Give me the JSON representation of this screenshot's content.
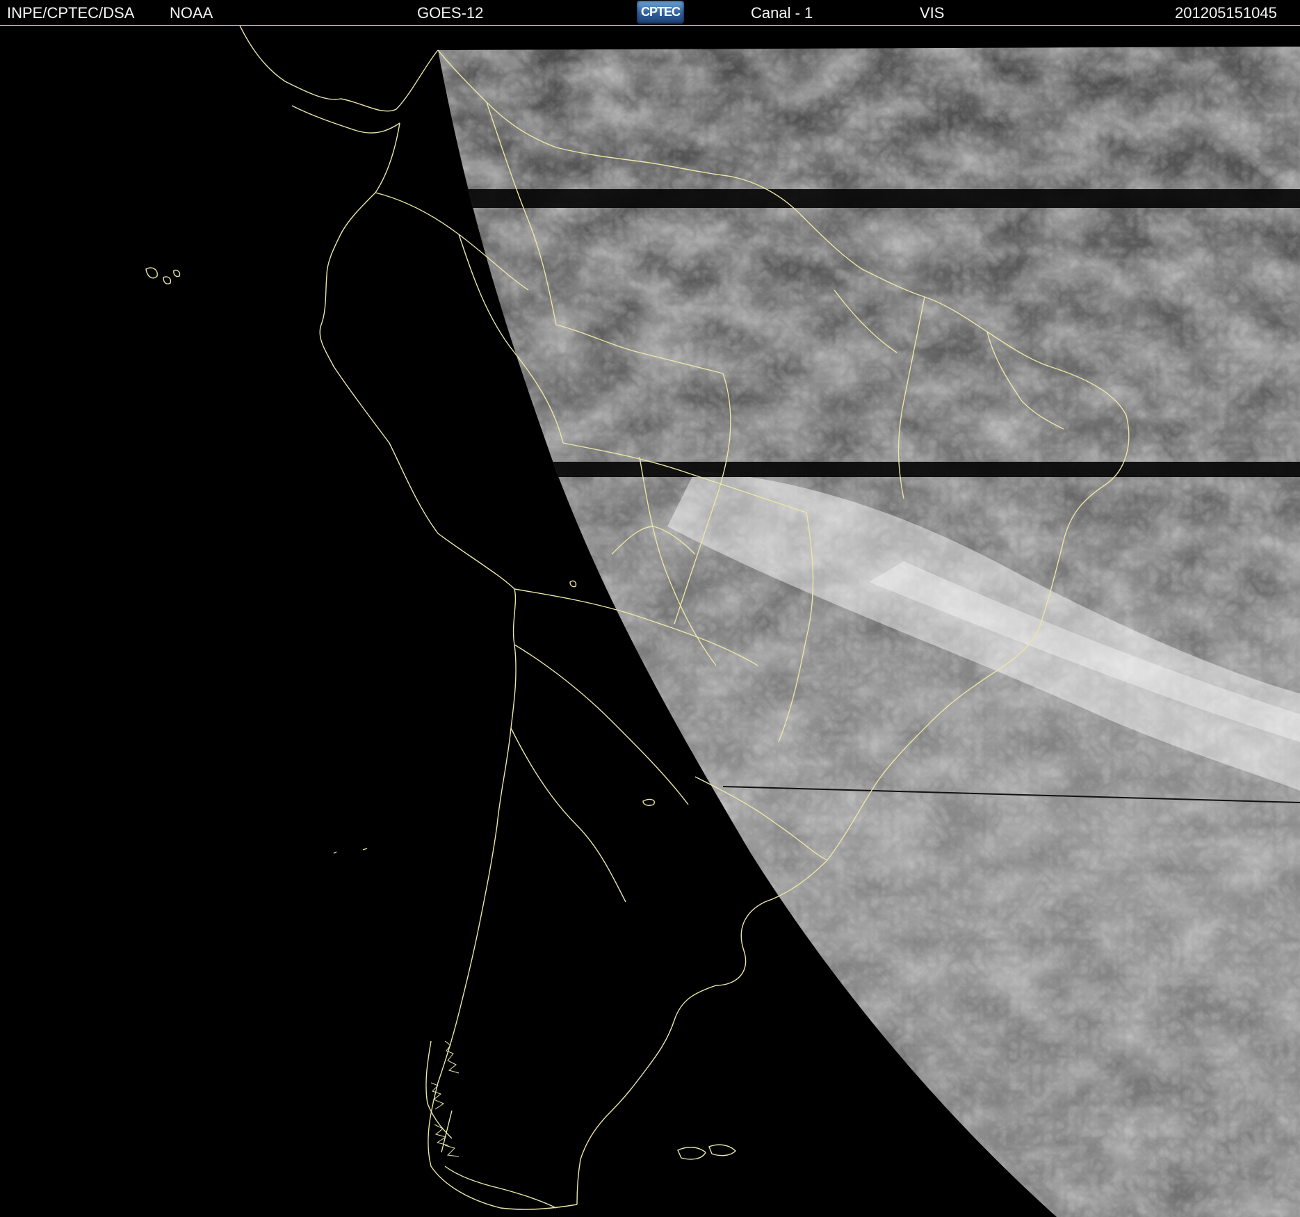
{
  "header": {
    "agency": "INPE/CPTEC/DSA",
    "partner": "NOAA",
    "satellite": "GOES-12",
    "logo_text": "CPTEC",
    "channel": "Canal - 1",
    "band": "VIS",
    "timestamp": "201205151045"
  },
  "image": {
    "background_color": "#000000",
    "coastline_color": "#e9e6a6",
    "cloud_color": "#ffffff",
    "ground_color": "#5a5a5a"
  }
}
